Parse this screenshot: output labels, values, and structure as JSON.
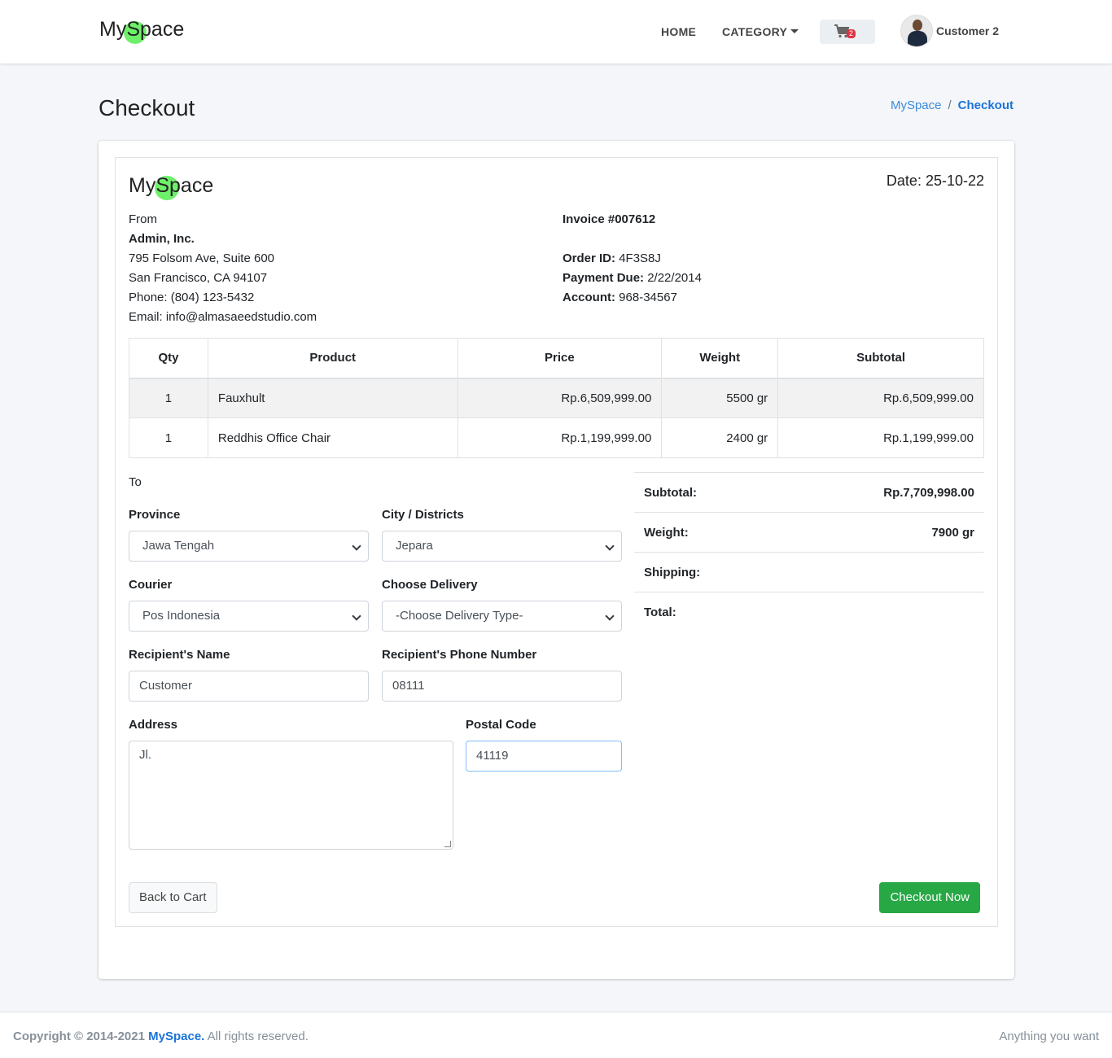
{
  "navbar": {
    "brand_pre": "My",
    "brand_mid": "S",
    "brand_post": "pace",
    "home": "HOME",
    "category": "CATEGORY",
    "cart_count": "2",
    "user_name": "Customer 2"
  },
  "page": {
    "title": "Checkout",
    "breadcrumb": [
      "MySpace",
      "/",
      "Checkout"
    ]
  },
  "invoice": {
    "brand_pre": "My",
    "brand_mid": "S",
    "brand_post": "pace",
    "date": "Date: 25-10-22",
    "from_label": "From",
    "company": "Admin, Inc.",
    "address1": "795 Folsom Ave, Suite 600",
    "address2": "San Francisco, CA 94107",
    "phone": "Phone: (804) 123-5432",
    "email": "Email: info@almasaeedstudio.com",
    "invoice_no": "Invoice #007612",
    "order_id_label": "Order ID:",
    "order_id": "4F3S8J",
    "payment_due_label": "Payment Due:",
    "payment_due": "2/22/2014",
    "account_label": "Account:",
    "account": "968-34567"
  },
  "table": {
    "headers": [
      "Qty",
      "Product",
      "Price",
      "Weight",
      "Subtotal"
    ],
    "rows": [
      {
        "qty": "1",
        "product": "Fauxhult",
        "price": "Rp.6,509,999.00",
        "weight": "5500 gr",
        "subtotal": "Rp.6,509,999.00"
      },
      {
        "qty": "1",
        "product": "Reddhis Office Chair",
        "price": "Rp.1,199,999.00",
        "weight": "2400 gr",
        "subtotal": "Rp.1,199,999.00"
      }
    ]
  },
  "form": {
    "to_label": "To",
    "province_label": "Province",
    "province_value": "Jawa Tengah",
    "city_label": "City / Districts",
    "city_value": "Jepara",
    "courier_label": "Courier",
    "courier_value": "Pos Indonesia",
    "delivery_label": "Choose Delivery",
    "delivery_value": "-Choose Delivery Type-",
    "recipient_name_label": "Recipient's Name",
    "recipient_name_value": "Customer",
    "recipient_phone_label": "Recipient's Phone Number",
    "recipient_phone_value": "08111",
    "address_label": "Address",
    "address_value": "Jl.",
    "postal_label": "Postal Code",
    "postal_value": "41119"
  },
  "summary": {
    "subtotal_label": "Subtotal:",
    "subtotal_value": "Rp.7,709,998.00",
    "weight_label": "Weight:",
    "weight_value": "7900 gr",
    "shipping_label": "Shipping:",
    "shipping_value": "",
    "total_label": "Total:",
    "total_value": ""
  },
  "buttons": {
    "back": "Back to Cart",
    "checkout": "Checkout Now"
  },
  "footer": {
    "copyright": "Copyright © 2014-2021",
    "brand": "MySpace.",
    "rights": "All rights reserved.",
    "right_text": "Anything you want"
  },
  "colors": {
    "accent": "#1b73d9",
    "success": "#28a745",
    "badge": "#dc3545",
    "logo_dot": "#6ef06a"
  }
}
